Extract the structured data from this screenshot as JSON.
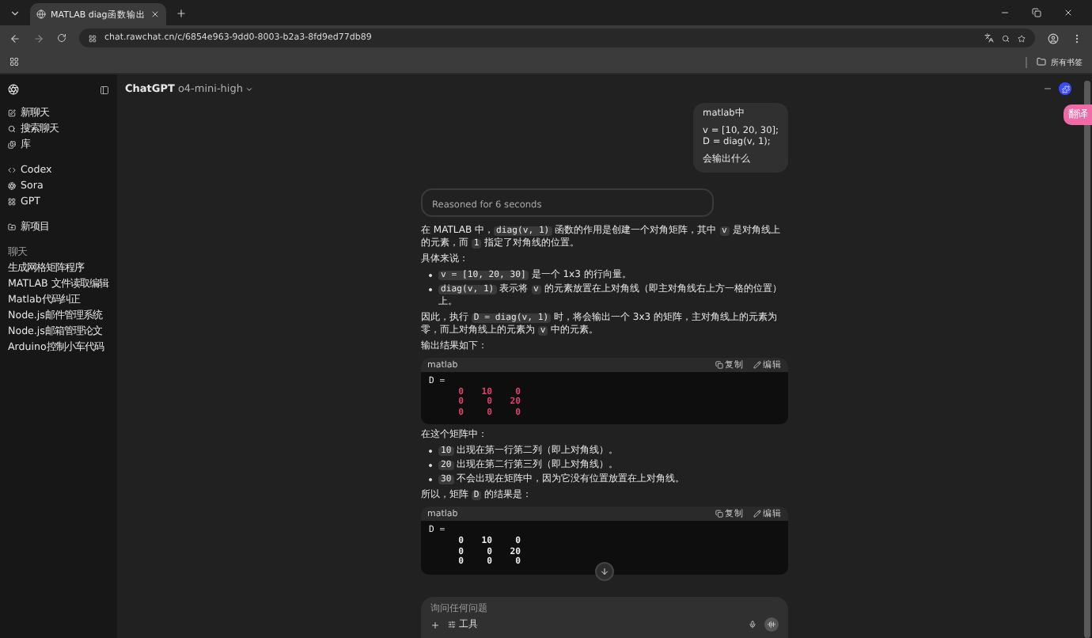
{
  "browser": {
    "tab_title": "MATLAB diag函数输出",
    "url": "chat.rawchat.cn/c/6854e963-9dd0-8003-b2a3-8fd9ed77db89",
    "bookmarks_label": "所有书签",
    "translate_badge": "翻译"
  },
  "sidebar": {
    "groups": [
      [
        "新聊天",
        "搜索聊天",
        "库"
      ],
      [
        "Codex",
        "Sora",
        "GPT"
      ],
      [
        "新项目"
      ]
    ],
    "chats_heading": "聊天",
    "chats": [
      "生成网格矩阵程序",
      "MATLAB 文件读取编辑",
      "Matlab代码纠正",
      "Node.js邮件管理系统",
      "Node.js邮箱管理论文",
      "Arduino控制小车代码"
    ]
  },
  "header": {
    "brand": "ChatGPT",
    "model": "o4-mini-high"
  },
  "user_message": [
    [
      "matlab中"
    ],
    [
      "v = [10, 20, 30];",
      "D = diag(v, 1);"
    ],
    [
      "会输出什么"
    ]
  ],
  "reasoning": "Reasoned for 6 seconds",
  "answer": [
    {
      "kind": "p",
      "segments": [
        {
          "t": "在 MATLAB 中，"
        },
        {
          "code": "diag(v, 1)"
        },
        {
          "t": " 函数的作用是创建一个对角矩阵，其中 "
        },
        {
          "code": "v"
        },
        {
          "t": " 是对角线上的元素，而 "
        },
        {
          "code": "1"
        },
        {
          "t": " 指定了对角线的位置。"
        }
      ]
    },
    {
      "kind": "p",
      "segments": [
        {
          "t": "具体来说："
        }
      ]
    },
    {
      "kind": "ul",
      "items": [
        [
          {
            "code": "v = [10, 20, 30]"
          },
          {
            "t": " 是一个 1x3 的行向量。"
          }
        ],
        [
          {
            "code": "diag(v, 1)"
          },
          {
            "t": " 表示将 "
          },
          {
            "code": "v"
          },
          {
            "t": " 的元素放置在上对角线（即主对角线右上方一格的位置）上。"
          }
        ]
      ]
    },
    {
      "kind": "p",
      "segments": [
        {
          "t": "因此，执行 "
        },
        {
          "code": "D = diag(v, 1)"
        },
        {
          "t": " 时，将会输出一个 3x3 的矩阵，主对角线上的元素为零，而上对角线上的元素为 "
        },
        {
          "code": "v"
        },
        {
          "t": " 中的元素。"
        }
      ]
    },
    {
      "kind": "p",
      "segments": [
        {
          "t": "输出结果如下："
        }
      ]
    },
    {
      "kind": "code",
      "lang": "matlab",
      "copy": "复制",
      "edit": "编辑",
      "title": "D =",
      "rows": [
        [
          "0",
          "10",
          "0"
        ],
        [
          "0",
          "0",
          "20"
        ],
        [
          "0",
          "0",
          "0"
        ]
      ],
      "highlighted": true
    },
    {
      "kind": "p",
      "segments": [
        {
          "t": "在这个矩阵中："
        }
      ]
    },
    {
      "kind": "ul",
      "items": [
        [
          {
            "code": "10"
          },
          {
            "t": " 出现在第一行第二列（即上对角线）。"
          }
        ],
        [
          {
            "code": "20"
          },
          {
            "t": " 出现在第二行第三列（即上对角线）。"
          }
        ],
        [
          {
            "code": "30"
          },
          {
            "t": " 不会出现在矩阵中，因为它没有位置放置在上对角线。"
          }
        ]
      ]
    },
    {
      "kind": "p",
      "segments": [
        {
          "t": "所以，矩阵 "
        },
        {
          "code": "D"
        },
        {
          "t": " 的结果是："
        }
      ]
    },
    {
      "kind": "code",
      "lang": "matlab",
      "copy": "复制",
      "edit": "编辑",
      "title": "D =",
      "rows": [
        [
          "0",
          "10",
          "0"
        ],
        [
          "0",
          "0",
          "20"
        ],
        [
          "0",
          "0",
          "0"
        ]
      ],
      "highlighted": false
    }
  ],
  "composer": {
    "placeholder": "询问任何问题",
    "tools": "工具"
  }
}
